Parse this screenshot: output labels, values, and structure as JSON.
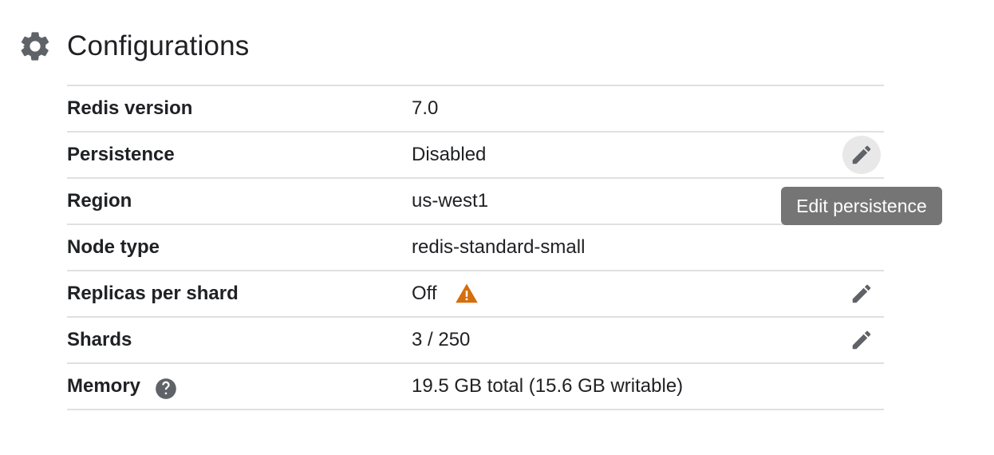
{
  "header": {
    "title": "Configurations",
    "icon": "gear-icon"
  },
  "rows": [
    {
      "label": "Redis version",
      "value": "7.0"
    },
    {
      "label": "Persistence",
      "value": "Disabled",
      "editable": true
    },
    {
      "label": "Region",
      "value": "us-west1"
    },
    {
      "label": "Node type",
      "value": "redis-standard-small"
    },
    {
      "label": "Replicas per shard",
      "value": "Off",
      "warning": true,
      "editable": true
    },
    {
      "label": "Shards",
      "value": "3 / 250",
      "editable": true
    },
    {
      "label": "Memory",
      "value": "19.5 GB total (15.6 GB writable)",
      "help": true
    }
  ],
  "tooltip": {
    "text": "Edit persistence"
  },
  "colors": {
    "text": "#202124",
    "icon": "#5f6368",
    "divider": "#e0e0e0",
    "warning": "#d56e0c",
    "tooltip_bg": "#757575",
    "hover_bg": "#e8e8e8"
  }
}
